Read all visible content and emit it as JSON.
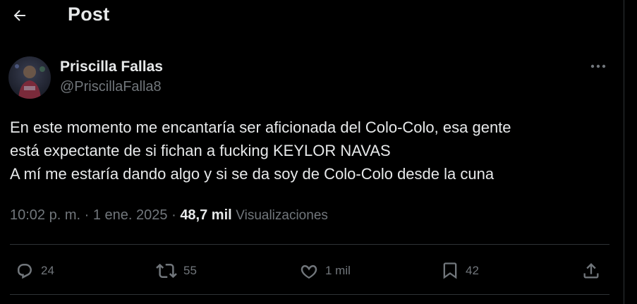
{
  "header": {
    "title": "Post",
    "back_icon": "arrow-left-icon"
  },
  "author": {
    "name": "Priscilla Fallas",
    "handle": "@PriscillaFalla8",
    "avatar_icon": "avatar"
  },
  "tweet": {
    "lines": [
      "En este momento me encantaría ser aficionada del Colo-Colo, esa gente",
      "está expectante de si fichan a fucking KEYLOR NAVAS",
      "A mí me estaría dando algo y si se da soy de Colo-Colo desde la cuna"
    ]
  },
  "meta": {
    "time": "10:02 p. m.",
    "sep": "·",
    "date": "1 ene. 2025",
    "views": "48,7 mil",
    "views_label": "Visualizaciones"
  },
  "actions": {
    "replies": "24",
    "reposts": "55",
    "likes": "1 mil",
    "bookmarks": "42"
  },
  "colors": {
    "background": "#000000",
    "text": "#e7e9ea",
    "muted": "#71767b",
    "border": "#2f3336"
  }
}
